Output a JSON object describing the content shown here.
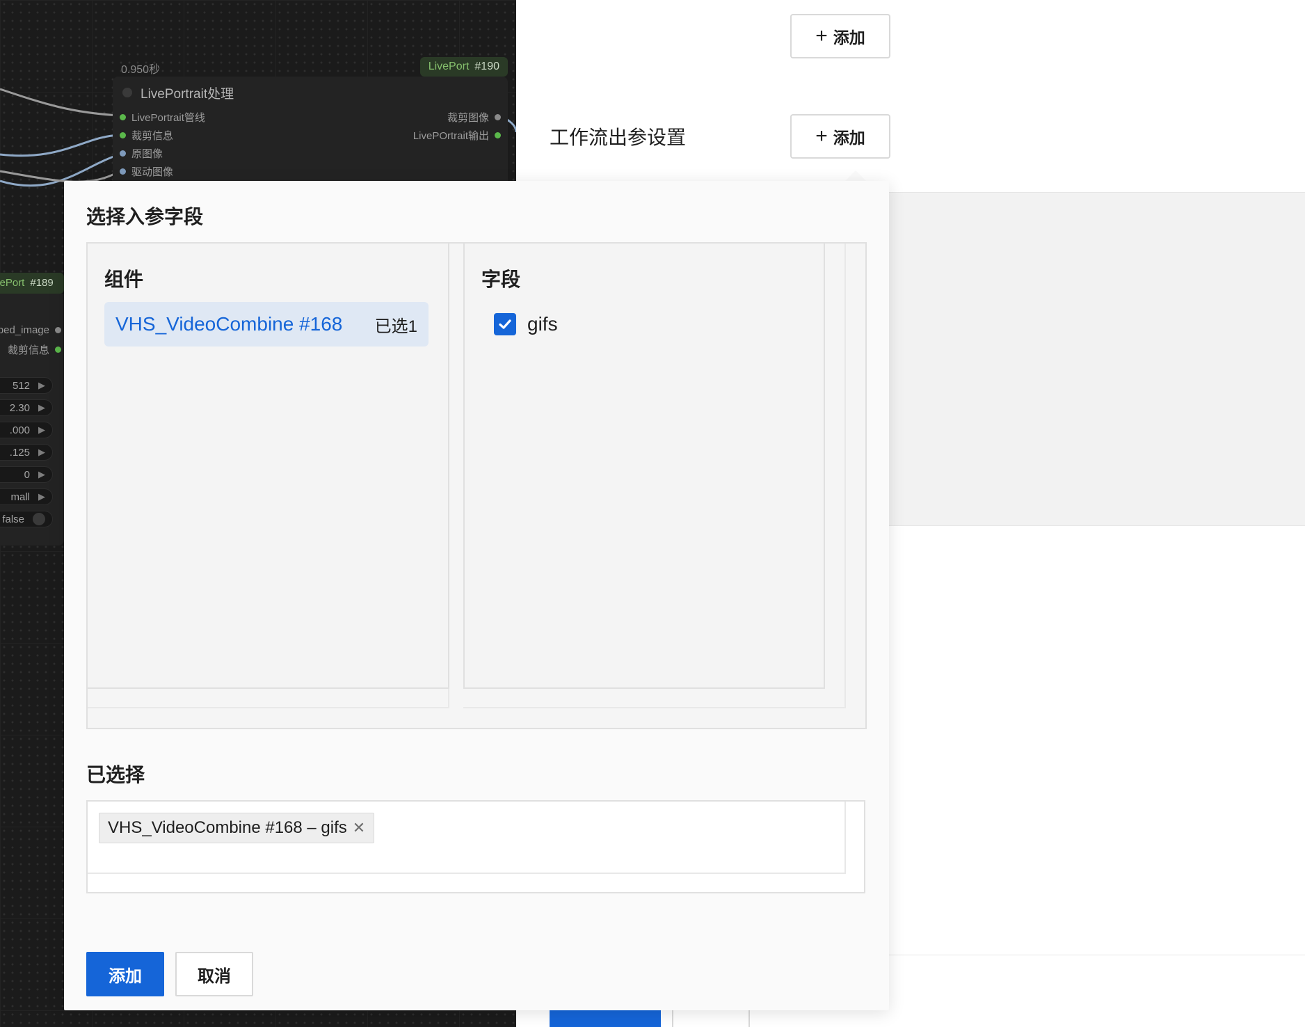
{
  "canvas": {
    "main_node": {
      "timing": "0.950秒",
      "badge_name": "LivePort",
      "badge_id": "#190",
      "title": "LivePortrait处理",
      "inputs": [
        "LivePortrait管线",
        "裁剪信息",
        "原图像",
        "驱动图像"
      ],
      "outputs": [
        "裁剪图像",
        "LivePOrtrait输出"
      ]
    },
    "left_node": {
      "badge_name": "vePort",
      "badge_id": "#189",
      "outputs": [
        "ped_image",
        "裁剪信息"
      ],
      "widgets": [
        "512",
        "2.30",
        ".000",
        ".125",
        "0",
        "mall",
        "false"
      ]
    }
  },
  "settings": {
    "top_add_label": "添加",
    "output_section_label": "工作流出参设置",
    "output_add_label": "添加"
  },
  "modal": {
    "title": "选择入参字段",
    "components_heading": "组件",
    "components": [
      {
        "name": "VHS_VideoCombine #168",
        "count_label": "已选1"
      }
    ],
    "fields_heading": "字段",
    "fields": [
      {
        "name": "gifs",
        "checked": true
      }
    ],
    "selected_heading": "已选择",
    "selected_tags": [
      "VHS_VideoCombine #168 – gifs"
    ],
    "confirm_label": "添加",
    "cancel_label": "取消"
  },
  "colors": {
    "primary": "#1565d8",
    "selected_item_bg": "#dfe8f4",
    "canvas_bg": "#1b1b1b",
    "connected_slot": "#5bb84b"
  }
}
